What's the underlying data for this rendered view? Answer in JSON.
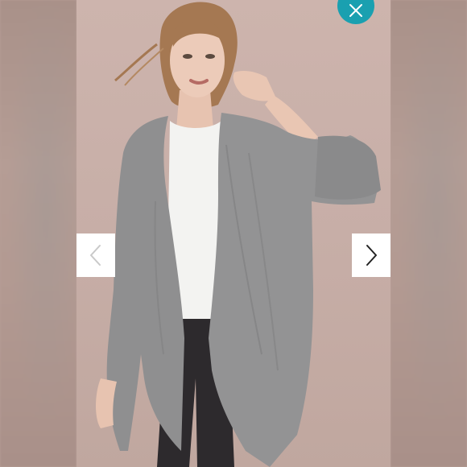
{
  "viewer": {
    "close_icon": "close-icon",
    "prev_icon": "chevron-left-icon",
    "next_icon": "chevron-right-icon",
    "accent_color": "#1aa0b0",
    "prev_arrow_color": "#c9c9c9",
    "next_arrow_color": "#222222"
  },
  "photo": {
    "subject": "product-photo",
    "background_color": "#c7aea7",
    "garment_color": "#8f8f90",
    "shirt_color": "#f3f3f1",
    "jeans_color": "#2d2a2d"
  }
}
